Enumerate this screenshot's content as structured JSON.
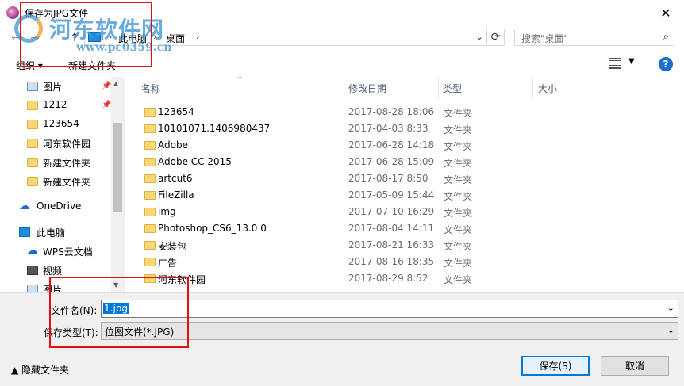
{
  "window": {
    "title": "保存为JPG文件",
    "close_glyph": "✕"
  },
  "watermark": {
    "title": "河东软件网",
    "url": "www.pc0359.cn"
  },
  "nav": {
    "back_glyph": "←",
    "forward_glyph": "→",
    "up_glyph": "↑",
    "address": [
      "此电脑",
      "桌面"
    ],
    "refresh_glyph": "⟳",
    "search_placeholder": "搜索\"桌面\""
  },
  "toolbar": {
    "organize": "组织 ▾",
    "new_folder": "新建文件夹",
    "help": "?"
  },
  "sidebar": {
    "items": [
      {
        "label": "图片",
        "icon": "image-icon",
        "pinned": true
      },
      {
        "label": "1212",
        "icon": "folder-icon",
        "pinned": true
      },
      {
        "label": "123654",
        "icon": "folder-icon",
        "pinned": false
      },
      {
        "label": "河东软件园",
        "icon": "folder-icon",
        "pinned": false
      },
      {
        "label": "新建文件夹",
        "icon": "folder-icon",
        "pinned": false
      },
      {
        "label": "新建文件夹",
        "icon": "folder-icon",
        "pinned": false
      },
      {
        "label": "OneDrive",
        "icon": "cloud-icon",
        "pinned": false
      },
      {
        "label": "此电脑",
        "icon": "computer-icon",
        "pinned": false
      },
      {
        "label": "WPS云文档",
        "icon": "cloud-icon",
        "pinned": false
      },
      {
        "label": "视频",
        "icon": "video-icon",
        "pinned": false
      },
      {
        "label": "图片",
        "icon": "image-icon",
        "pinned": false
      }
    ]
  },
  "columns": {
    "name": "名称",
    "date": "修改日期",
    "type": "类型",
    "size": "大小"
  },
  "files": [
    {
      "name": "123654",
      "date": "2017-08-28 18:06",
      "type": "文件夹"
    },
    {
      "name": "10101071.1406980437",
      "date": "2017-04-03 8:33",
      "type": "文件夹"
    },
    {
      "name": "Adobe",
      "date": "2017-06-28 14:18",
      "type": "文件夹"
    },
    {
      "name": "Adobe CC 2015",
      "date": "2017-06-28 15:09",
      "type": "文件夹"
    },
    {
      "name": "artcut6",
      "date": "2017-08-17 8:50",
      "type": "文件夹"
    },
    {
      "name": "FileZilla",
      "date": "2017-05-09 15:44",
      "type": "文件夹"
    },
    {
      "name": "img",
      "date": "2017-07-10 16:29",
      "type": "文件夹"
    },
    {
      "name": "Photoshop_CS6_13.0.0",
      "date": "2017-08-04 14:11",
      "type": "文件夹"
    },
    {
      "name": "安装包",
      "date": "2017-08-21 16:33",
      "type": "文件夹"
    },
    {
      "name": "广告",
      "date": "2017-08-16 18:35",
      "type": "文件夹"
    },
    {
      "name": "河东软件园",
      "date": "2017-08-29 8:52",
      "type": "文件夹"
    }
  ],
  "form": {
    "filename_label": "文件名(N):",
    "filename_value": "1.jpg",
    "filetype_label": "保存类型(T):",
    "filetype_value": "位图文件(*.JPG)",
    "hide_folders": "▲ 隐藏文件夹",
    "save": "保存(S)",
    "cancel": "取消"
  },
  "colors": {
    "accent": "#0078d7",
    "highlight_box": "#e01010",
    "folder": "#f8d775"
  }
}
